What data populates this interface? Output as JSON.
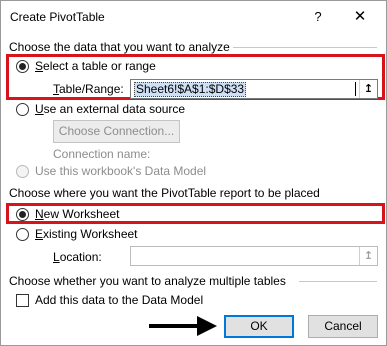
{
  "dialog": {
    "title": "Create PivotTable",
    "help_label": "?",
    "close_label": "✕"
  },
  "section1": {
    "heading": "Choose the data that you want to analyze",
    "option_table": {
      "accel": "S",
      "rest": "elect a table or range",
      "checked": true
    },
    "table_range": {
      "label_accel": "T",
      "label_rest": "able/Range:",
      "value": "Sheet6!$A$1:$D$33",
      "ref_icon": "↥"
    },
    "option_external": {
      "accel": "U",
      "rest": "se an external data source",
      "checked": false
    },
    "choose_connection_button": "Choose Connection...",
    "connection_name_label": "Connection name:",
    "option_data_model": {
      "label": "Use this workbook's Data Model",
      "disabled": true
    }
  },
  "section2": {
    "heading": "Choose where you want the PivotTable report to be placed",
    "option_new": {
      "accel": "N",
      "rest": "ew Worksheet",
      "checked": true
    },
    "option_existing": {
      "accel": "E",
      "rest": "xisting Worksheet",
      "checked": false
    },
    "location": {
      "label_accel": "L",
      "label_rest": "ocation:",
      "value": "",
      "ref_icon": "↥"
    }
  },
  "section3": {
    "heading": "Choose whether you want to analyze multiple tables",
    "add_to_data_model": {
      "label": "Add this data to the Data Model",
      "checked": false
    }
  },
  "footer": {
    "ok_label": "OK",
    "cancel_label": "Cancel"
  },
  "colors": {
    "highlight_box": "#d7141c",
    "default_button_border": "#0078d7",
    "selection": "#cfe0f4",
    "arrow": "#000000"
  },
  "icons": {
    "pointing_arrow": "arrow-right-icon"
  }
}
